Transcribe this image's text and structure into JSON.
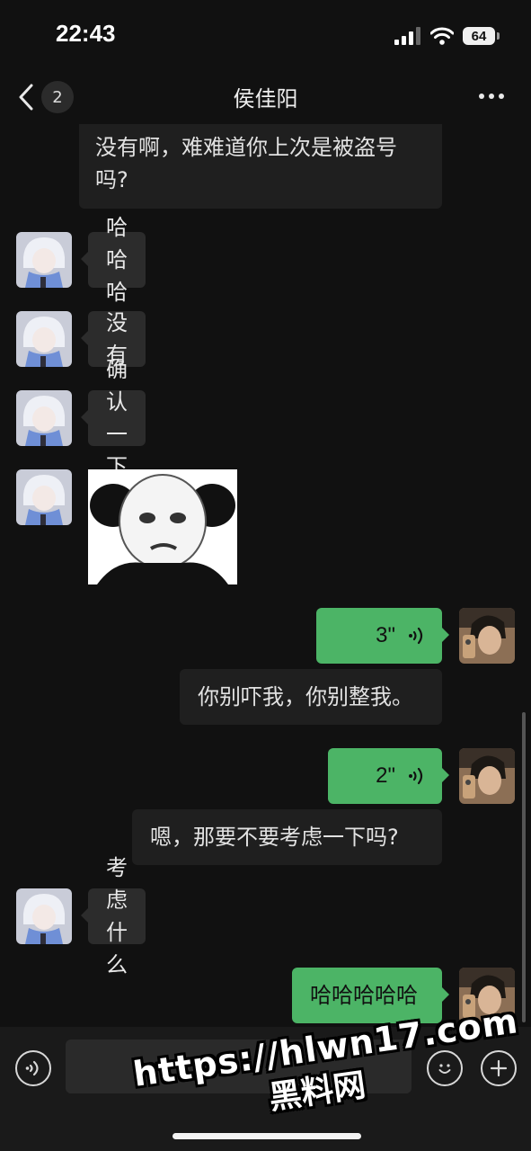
{
  "status_bar": {
    "time": "22:43",
    "battery": "64"
  },
  "header": {
    "unread_count": "2",
    "title": "侯佳阳"
  },
  "messages": [
    {
      "text": "没有啊，难难道你上次是被盗号吗?"
    },
    {
      "text": "哈哈哈"
    },
    {
      "text": "没有"
    },
    {
      "text": "确认一下"
    },
    {
      "text": ""
    },
    {
      "text": "3\""
    },
    {
      "text": "你别吓我，你别整我。"
    },
    {
      "text": "2\""
    },
    {
      "text": "嗯，那要不要考虑一下吗?"
    },
    {
      "text": "考虑什么"
    },
    {
      "text": "哈哈哈哈哈"
    }
  ],
  "input": {
    "value": ""
  },
  "watermark": {
    "line1": "https://hlwn17.com",
    "line2": "黑料网"
  },
  "colors": {
    "background": "#111111",
    "incoming_bubble": "#2c2c2c",
    "outgoing_bubble": "#4cb466",
    "transcript_bubble": "#1f1f1f"
  }
}
